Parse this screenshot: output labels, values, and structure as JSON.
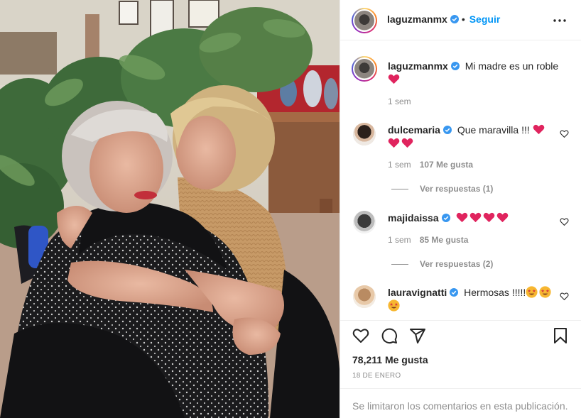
{
  "post": {
    "username": "laguzmanmx",
    "follow_label": "Seguir",
    "dot": "•"
  },
  "caption": {
    "username": "laguzmanmx",
    "text": "Mi madre es un roble",
    "emoji": [
      "red-heart"
    ],
    "time": "1 sem"
  },
  "comments": [
    {
      "username": "dulcemaria",
      "text": "Que maravilla !!!",
      "emoji_after": [
        "red-heart"
      ],
      "emoji_line2": [
        "red-heart",
        "red-heart"
      ],
      "time": "1 sem",
      "likes": "107 Me gusta",
      "replies": "Ver respuestas (1)"
    },
    {
      "username": "majidaissa",
      "text": "",
      "emoji_after": [
        "red-heart",
        "red-heart",
        "red-heart",
        "red-heart"
      ],
      "time": "1 sem",
      "likes": "85 Me gusta",
      "replies": "Ver respuestas (2)"
    },
    {
      "username": "lauravignatti",
      "text": "Hermosas !!!!!",
      "emoji_after": [
        "star-struck",
        "star-struck"
      ],
      "emoji_line2": [
        "star-struck"
      ]
    }
  ],
  "actions": {
    "icons": [
      "heart-icon",
      "comment-icon",
      "share-icon",
      "save-icon"
    ]
  },
  "likes_text": "78,211 Me gusta",
  "date_text": "18 DE ENERO",
  "comments_limited": "Se limitaron los comentarios en esta publicación.",
  "colors": {
    "accent": "#0095f6",
    "text": "#262626",
    "muted": "#8e8e8e",
    "heart": "#ed4956",
    "verified": "#3897f0"
  }
}
